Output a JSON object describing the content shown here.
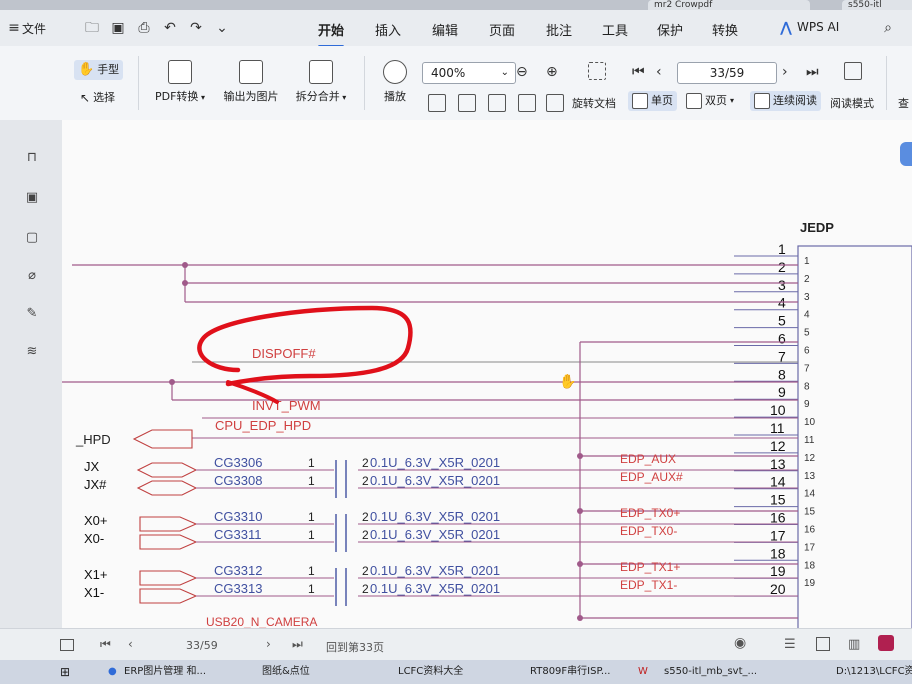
{
  "tabs": [
    "mr2 Crowpdf",
    "s550-itl"
  ],
  "menu": {
    "file": "文件",
    "items": [
      "开始",
      "插入",
      "编辑",
      "页面",
      "批注",
      "工具",
      "保护",
      "转换"
    ],
    "active": "开始",
    "ai": "WPS AI"
  },
  "ribbon": {
    "hand": "手型",
    "select": "选择",
    "pdf_convert": "PDF转换",
    "export_image": "输出为图片",
    "split_merge": "拆分合并",
    "play": "播放",
    "zoom": "400%",
    "rotate": "旋转文档",
    "page": "33/59",
    "single": "单页",
    "double": "双页",
    "continuous": "连续阅读",
    "read_mode": "阅读模式",
    "cut_off": "查"
  },
  "schematic": {
    "ref": "JEDP",
    "pins_left": [
      "1",
      "2",
      "3",
      "4",
      "5",
      "6",
      "7",
      "8",
      "9",
      "10",
      "11",
      "12",
      "13",
      "14",
      "15",
      "16",
      "17",
      "18",
      "19",
      "20"
    ],
    "pins_right": [
      "1",
      "2",
      "3",
      "4",
      "5",
      "6",
      "7",
      "8",
      "9",
      "10",
      "11",
      "12",
      "13",
      "14",
      "15",
      "16",
      "17",
      "18",
      "19"
    ],
    "nets": {
      "dispoff": "DISPOFF#",
      "invt_pwm": "INVT_PWM",
      "cpu_edp_hpd": "CPU_EDP_HPD",
      "hpd": "_HPD",
      "aux_p_left": "JX",
      "aux_n_left": "JX#",
      "tx0p_left": "X0+",
      "tx0n_left": "X0-",
      "tx1p_left": "X1+",
      "tx1n_left": "X1-",
      "edp_aux": "EDP_AUX",
      "edp_aux_n": "EDP_AUX#",
      "edp_tx0p": "EDP_TX0+",
      "edp_tx0n": "EDP_TX0-",
      "edp_tx1p": "EDP_TX1+",
      "edp_tx1n": "EDP_TX1-",
      "usb_camera": "USB20_N_CAMERA"
    },
    "caps": [
      {
        "ref": "CG3306",
        "p1": "1",
        "p2": "2",
        "val": "0.1U_6.3V_X5R_0201"
      },
      {
        "ref": "CG3308",
        "p1": "1",
        "p2": "2",
        "val": "0.1U_6.3V_X5R_0201"
      },
      {
        "ref": "CG3310",
        "p1": "1",
        "p2": "2",
        "val": "0.1U_6.3V_X5R_0201"
      },
      {
        "ref": "CG3311",
        "p1": "1",
        "p2": "2",
        "val": "0.1U_6.3V_X5R_0201"
      },
      {
        "ref": "CG3312",
        "p1": "1",
        "p2": "2",
        "val": "0.1U_6.3V_X5R_0201"
      },
      {
        "ref": "CG3313",
        "p1": "1",
        "p2": "2",
        "val": "0.1U_6.3V_X5R_0201"
      }
    ]
  },
  "status": {
    "page": "33/59",
    "back": "回到第33页"
  },
  "taskbar": [
    "ERP图片管理 和...",
    "图纸&点位",
    "LCFC资料大全",
    "RT809F串行ISP...",
    "s550-itl_mb_svt_...",
    "D:\\1213\\LCFC资"
  ],
  "colors": {
    "accent": "#2f6bd8",
    "wire": "#a05a8a",
    "net_red": "#d04040",
    "part_blue": "#4050a0",
    "marker": "#e0101a"
  }
}
